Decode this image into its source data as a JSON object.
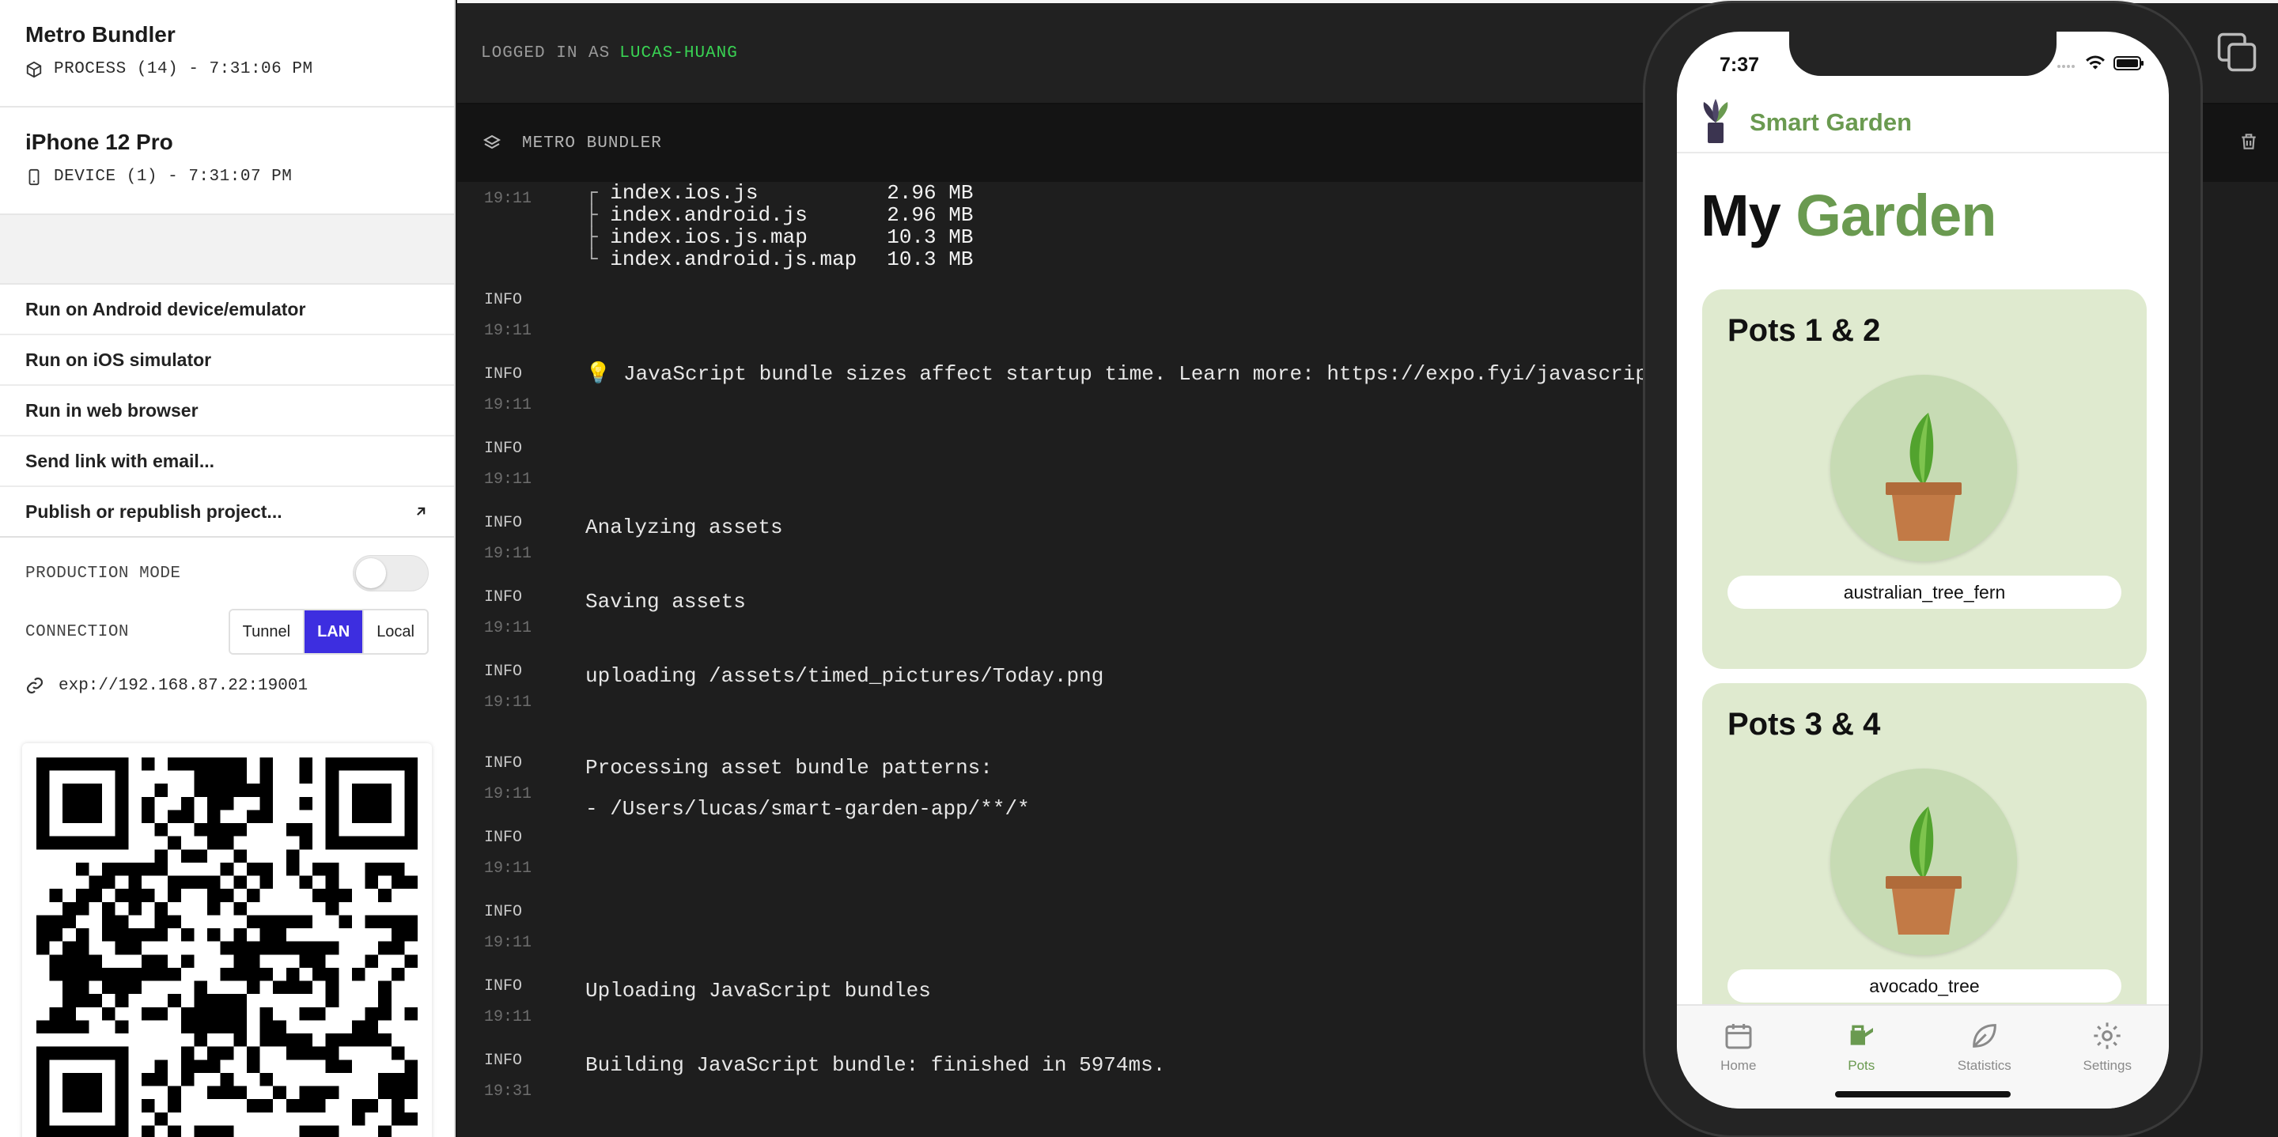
{
  "processes": [
    {
      "title": "Metro Bundler",
      "subtitle": "PROCESS (14) - 7:31:06 PM",
      "icon": "cube-icon"
    },
    {
      "title": "iPhone 12 Pro",
      "subtitle": "DEVICE (1) - 7:31:07 PM",
      "icon": "phone-icon"
    }
  ],
  "actions": {
    "android": "Run on Android device/emulator",
    "ios": "Run on iOS simulator",
    "web": "Run in web browser",
    "email": "Send link with email...",
    "publish": "Publish or republish project..."
  },
  "settings": {
    "production_label": "PRODUCTION MODE",
    "production_enabled": false,
    "connection_label": "CONNECTION",
    "connection_options": [
      "Tunnel",
      "LAN",
      "Local"
    ],
    "connection_selected": "LAN",
    "url": "exp://192.168.87.22:19001"
  },
  "console": {
    "logged_in_prefix": "LOGGED IN AS",
    "username": "LUCAS-HUANG",
    "tab_label": "METRO BUNDLER",
    "bundle_sizes": [
      {
        "file": "index.ios.js",
        "size": "2.96 MB"
      },
      {
        "file": "index.android.js",
        "size": "2.96 MB"
      },
      {
        "file": "index.ios.js.map",
        "size": "10.3 MB"
      },
      {
        "file": "index.android.js.map",
        "size": "10.3 MB"
      }
    ],
    "first_time": "19:11",
    "entries": [
      {
        "level": "INFO",
        "time": "19:11",
        "message": ""
      },
      {
        "level": "INFO",
        "time": "19:11",
        "message": "💡 JavaScript bundle sizes affect startup time. Learn more: https://expo.fyi/javascrip"
      },
      {
        "level": "INFO",
        "time": "19:11",
        "message": ""
      },
      {
        "level": "INFO",
        "time": "19:11",
        "message": "Analyzing assets"
      },
      {
        "level": "INFO",
        "time": "19:11",
        "message": "Saving assets"
      },
      {
        "level": "INFO",
        "time": "19:11",
        "message": "uploading /assets/timed_pictures/Today.png"
      },
      {
        "level": "INFO",
        "time": "19:11",
        "message": "Processing asset bundle patterns:"
      },
      {
        "level": "INFO",
        "time": "19:11",
        "message": "- /Users/lucas/smart-garden-app/**/*"
      },
      {
        "level": "INFO",
        "time": "19:11",
        "message": ""
      },
      {
        "level": "INFO",
        "time": "19:11",
        "message": "Uploading JavaScript bundles"
      },
      {
        "level": "INFO",
        "time": "19:31",
        "message": "Building JavaScript bundle: finished in 5974ms."
      }
    ]
  },
  "phone": {
    "status_time": "7:37",
    "app_name": "Smart Garden",
    "title_part1": "My",
    "title_part2": "Garden",
    "cards": [
      {
        "name": "Pots 1 & 2",
        "plant": "australian_tree_fern"
      },
      {
        "name": "Pots 3 & 4",
        "plant": "avocado_tree"
      }
    ],
    "tabs": [
      {
        "label": "Home",
        "icon": "calendar-icon"
      },
      {
        "label": "Pots",
        "icon": "watering-can-icon"
      },
      {
        "label": "Statistics",
        "icon": "leaf-icon"
      },
      {
        "label": "Settings",
        "icon": "gear-icon"
      }
    ],
    "active_tab": "Pots"
  },
  "colors": {
    "accent": "#3d2ee0",
    "username": "#39d353",
    "garden_green": "#6a9a50",
    "card_bg": "#dfeacf"
  }
}
